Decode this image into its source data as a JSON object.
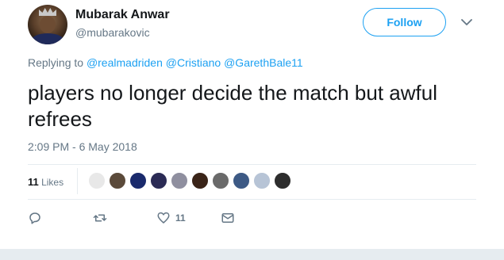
{
  "user": {
    "name": "Mubarak Anwar",
    "handle": "@mubarakovic"
  },
  "follow_label": "Follow",
  "replying": {
    "prefix": "Replying to",
    "mentions": [
      "@realmadriden",
      "@Cristiano",
      "@GarethBale11"
    ]
  },
  "tweet_text": "players no longer decide the match but awful refrees",
  "timestamp": "2:09 PM - 6 May 2018",
  "stats": {
    "likes_count": "11",
    "likes_label": "Likes"
  },
  "actions": {
    "like_count": "11"
  },
  "colors": {
    "accent": "#1da1f2",
    "secondary_text": "#657786",
    "divider": "#e6ecf0"
  },
  "likers": [
    {
      "name": "real-madrid-crest",
      "color": "#e8e8e8"
    },
    {
      "name": "user-avatar",
      "color": "#5b4a3a"
    },
    {
      "name": "user-avatar",
      "color": "#1a2a6c"
    },
    {
      "name": "user-avatar",
      "color": "#2b2b55"
    },
    {
      "name": "user-avatar",
      "color": "#8f8f9f"
    },
    {
      "name": "user-avatar",
      "color": "#3a2418"
    },
    {
      "name": "user-avatar",
      "color": "#6a6a6a"
    },
    {
      "name": "user-avatar",
      "color": "#3d5a85"
    },
    {
      "name": "user-avatar",
      "color": "#b7c4d6"
    },
    {
      "name": "user-avatar",
      "color": "#2d2d2d"
    }
  ]
}
